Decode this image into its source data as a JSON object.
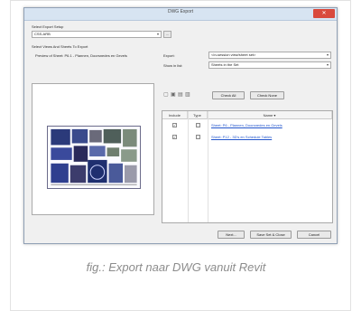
{
  "window": {
    "title": "DWG Export",
    "close_symbol": "✕"
  },
  "export_setup": {
    "label": "Select Export Setup",
    "value": "CSS-ARB",
    "more_button": "..."
  },
  "views_label": "Select Views And Sheets To Export",
  "preview_label": "Preview of Sheet: P6.1 - Plannen, Doorsnedes en Gevels",
  "export": {
    "label": "Export:",
    "value": "<In-session view/sheet set>"
  },
  "show_in_list": {
    "label": "Show in list:",
    "value": "Sheets in the Set"
  },
  "toolbar": {
    "check_all": "Check All",
    "check_none": "Check None"
  },
  "table": {
    "headers": {
      "include": "Include",
      "type": "Type",
      "name": "Name"
    },
    "rows": [
      {
        "included": true,
        "name": "Sheet: P6 - Plannen, Doorsnedes en Gevels"
      },
      {
        "included": true,
        "name": "Sheet: P12 - 3D's en Schedule Tables"
      }
    ]
  },
  "footer": {
    "next": "Next...",
    "save_close": "Save Set & Close",
    "cancel": "Cancel"
  },
  "caption": "fig.: Export naar DWG vanuit Revit",
  "colors": {
    "title_bar": "#d7e4f2",
    "close": "#d9493c",
    "link": "#2255cc"
  }
}
